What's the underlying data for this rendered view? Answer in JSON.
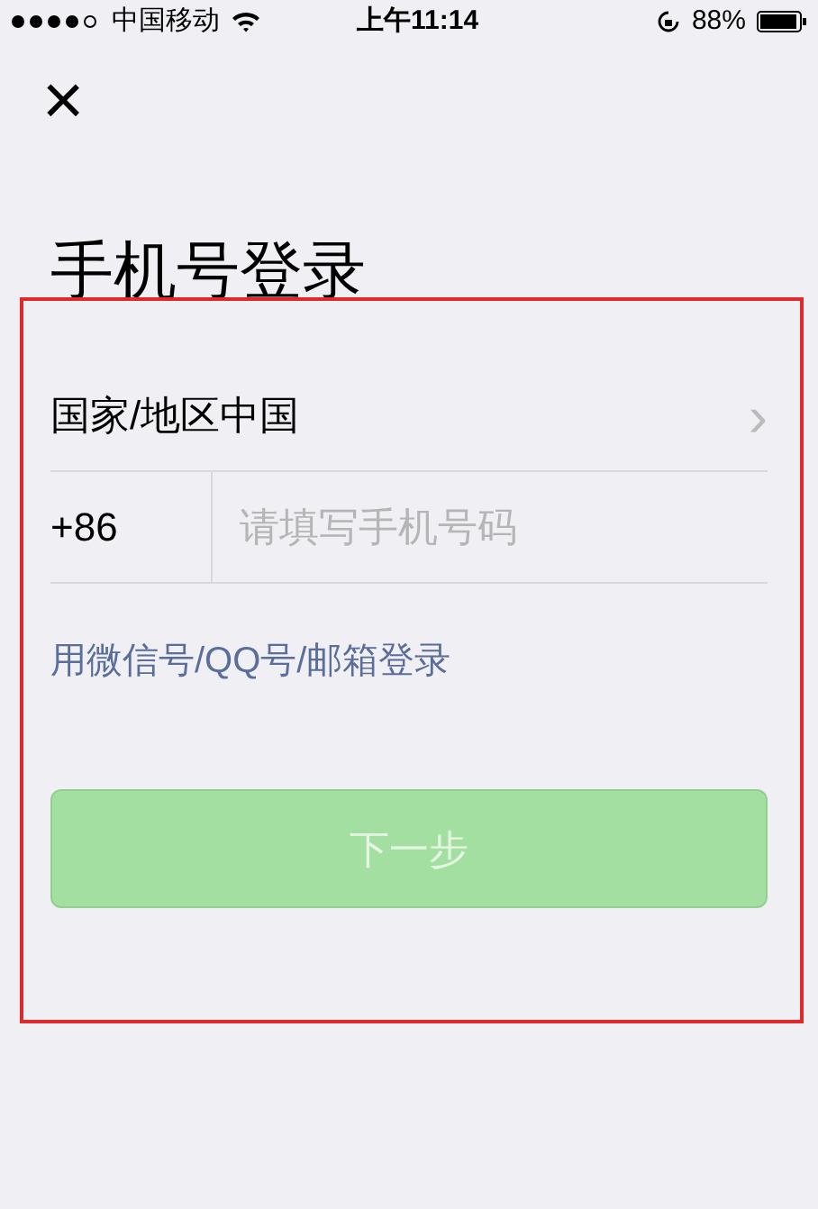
{
  "status_bar": {
    "carrier": "中国移动",
    "time": "上午11:14",
    "battery": "88%"
  },
  "close": {
    "label": "×"
  },
  "title": "手机号登录",
  "country": {
    "label": "国家/地区",
    "value": "中国",
    "chevron": "›"
  },
  "phone": {
    "code": "+86",
    "placeholder": "请填写手机号码"
  },
  "alt_login": "用微信号/QQ号/邮箱登录",
  "next_button": {
    "label": "下一步",
    "disabled": true
  },
  "highlight": {
    "color": "#e02a2a"
  }
}
